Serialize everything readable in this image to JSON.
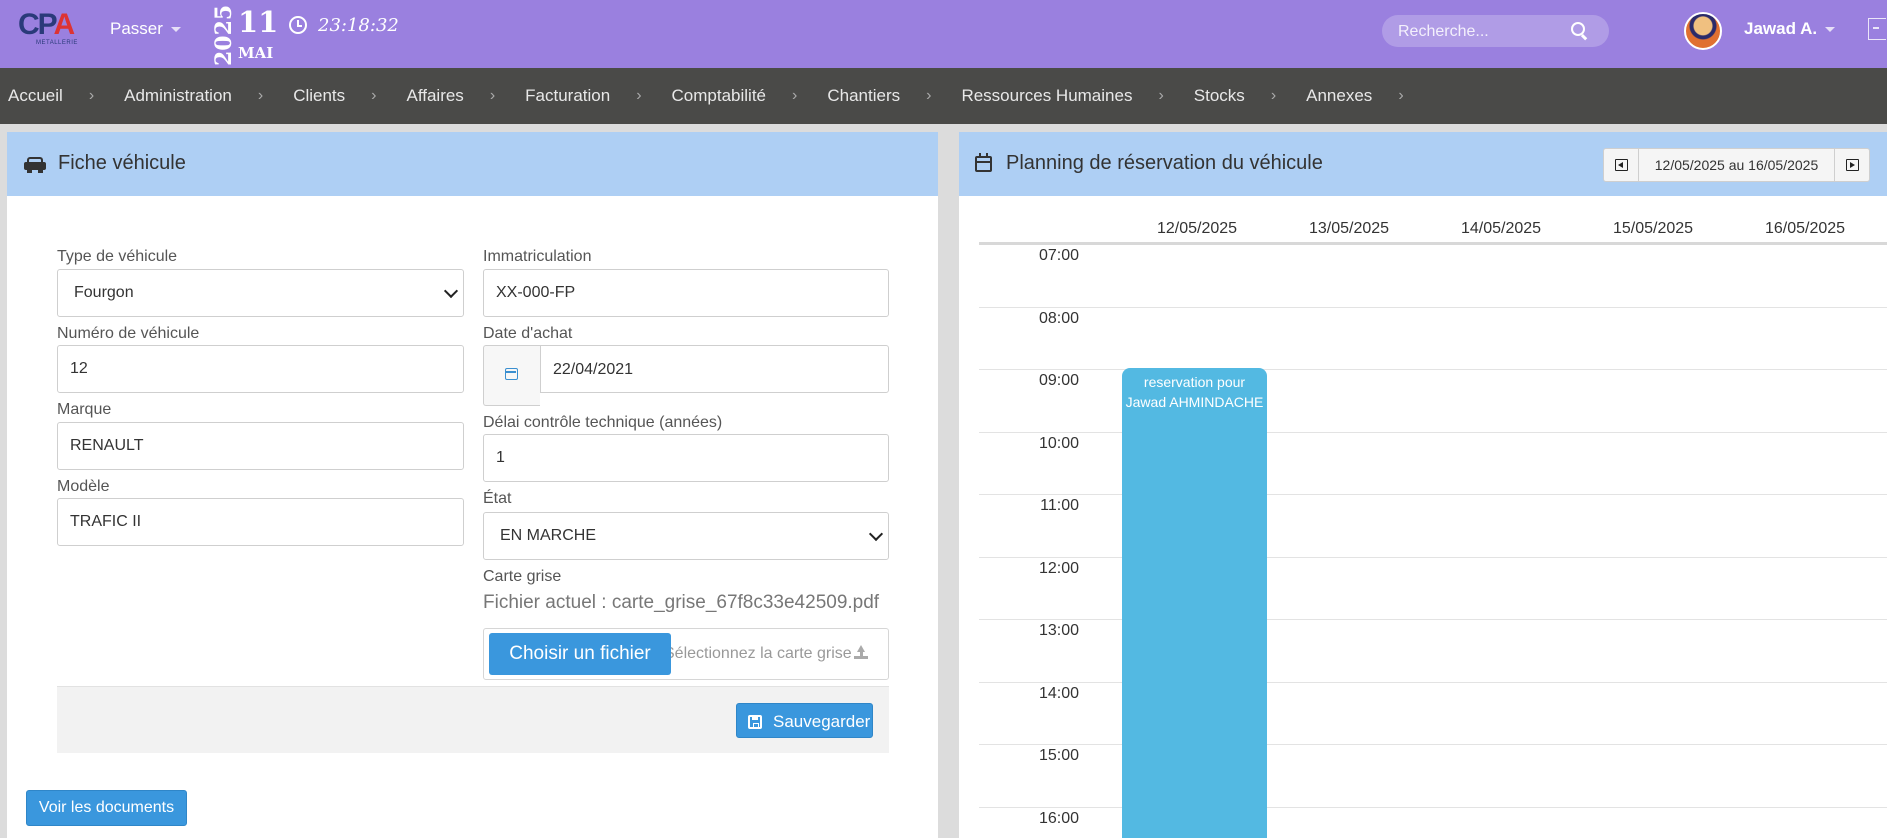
{
  "topbar": {
    "logo_main": "CP",
    "logo_accent": "A",
    "logo_sub": "METALLERIE",
    "passer_label": "Passer",
    "date": {
      "year": "2025",
      "day": "11",
      "month": "MAI"
    },
    "time": "23:18:32",
    "search_placeholder": "Recherche...",
    "username": "Jawad A."
  },
  "nav": {
    "items": [
      {
        "label": "Accueil"
      },
      {
        "label": "Administration"
      },
      {
        "label": "Clients"
      },
      {
        "label": "Affaires"
      },
      {
        "label": "Facturation"
      },
      {
        "label": "Comptabilité"
      },
      {
        "label": "Chantiers"
      },
      {
        "label": "Ressources Humaines"
      },
      {
        "label": "Stocks"
      },
      {
        "label": "Annexes"
      }
    ],
    "separator": "›"
  },
  "vehicle": {
    "title": "Fiche véhicule",
    "type": {
      "label": "Type de véhicule",
      "value": "Fourgon"
    },
    "immat": {
      "label": "Immatriculation",
      "value": "XX-000-FP"
    },
    "numero": {
      "label": "Numéro de véhicule",
      "value": "12"
    },
    "date_achat": {
      "label": "Date d'achat",
      "value": "22/04/2021"
    },
    "marque": {
      "label": "Marque",
      "value": "RENAULT"
    },
    "delai": {
      "label": "Délai contrôle technique (années)",
      "value": "1"
    },
    "modele": {
      "label": "Modèle",
      "value": "TRAFIC II"
    },
    "etat": {
      "label": "État",
      "value": "EN MARCHE"
    },
    "carte_grise": {
      "label": "Carte grise",
      "current_file": "Fichier actuel : carte_grise_67f8c33e42509.pdf",
      "choose_label": "Choisir un fichier",
      "hint": "Sélectionnez la carte grise"
    },
    "save_label": "Sauvegarder",
    "docs_label": "Voir les documents"
  },
  "planning": {
    "title": "Planning de réservation du véhicule",
    "week_range": "12/05/2025 au 16/05/2025",
    "days": [
      "12/05/2025",
      "13/05/2025",
      "14/05/2025",
      "15/05/2025",
      "16/05/2025"
    ],
    "hours": [
      "07:00",
      "08:00",
      "09:00",
      "10:00",
      "11:00",
      "12:00",
      "13:00",
      "14:00",
      "15:00",
      "16:00"
    ],
    "event": {
      "text_line1": "reservation pour",
      "text_line2": "Jawad AHMINDACHE",
      "day": "12/05/2025",
      "start": "09:00"
    },
    "colors": {
      "header": "#aecff4",
      "event": "#53b9e2"
    }
  },
  "colors": {
    "topbar": "#9a80df",
    "navbar": "#4a4a48",
    "button": "#3a97dd"
  }
}
